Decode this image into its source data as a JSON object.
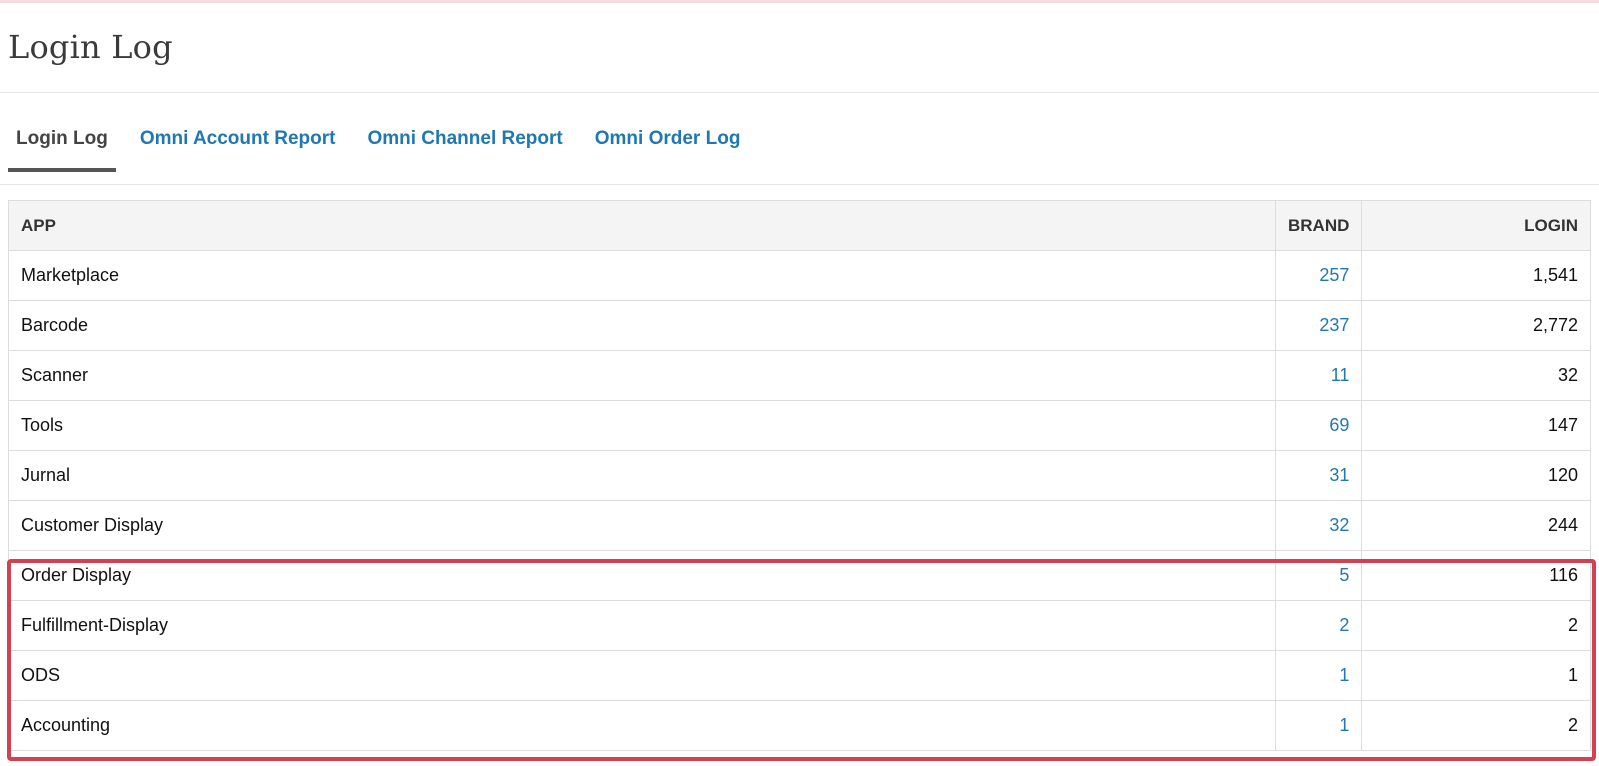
{
  "page": {
    "title": "Login Log"
  },
  "tabs": [
    {
      "label": "Login Log",
      "active": true
    },
    {
      "label": "Omni Account Report",
      "active": false
    },
    {
      "label": "Omni Channel Report",
      "active": false
    },
    {
      "label": "Omni Order Log",
      "active": false
    }
  ],
  "table": {
    "headers": {
      "app": "APP",
      "brand": "BRAND",
      "login": "LOGIN"
    },
    "rows": [
      {
        "app": "Marketplace",
        "brand": "257",
        "login": "1,541"
      },
      {
        "app": "Barcode",
        "brand": "237",
        "login": "2,772"
      },
      {
        "app": "Scanner",
        "brand": "11",
        "login": "32"
      },
      {
        "app": "Tools",
        "brand": "69",
        "login": "147"
      },
      {
        "app": "Jurnal",
        "brand": "31",
        "login": "120"
      },
      {
        "app": "Customer Display",
        "brand": "32",
        "login": "244"
      },
      {
        "app": "Order Display",
        "brand": "5",
        "login": "116"
      },
      {
        "app": "Fulfillment-Display",
        "brand": "2",
        "login": "2"
      },
      {
        "app": "ODS",
        "brand": "1",
        "login": "1"
      },
      {
        "app": "Accounting",
        "brand": "1",
        "login": "2"
      }
    ]
  },
  "colors": {
    "link": "#1f78b4",
    "highlight": "#d1414f",
    "header_bg": "#f4f4f4"
  }
}
